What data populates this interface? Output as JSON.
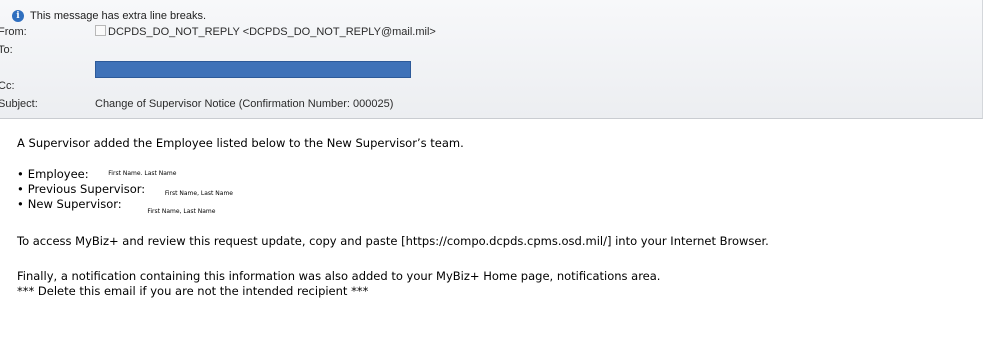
{
  "header": {
    "info_text": "This message has extra line breaks.",
    "info_icon": "info-icon",
    "from_label": "From:",
    "from_value": "DCPDS_DO_NOT_REPLY <DCPDS_DO_NOT_REPLY@mail.mil>",
    "to_label": "To:",
    "cc_label": "Cc:",
    "subject_label": "Subject:",
    "subject_value": "Change of Supervisor Notice (Confirmation Number: 000025)",
    "redaction_color": "#3f72b8"
  },
  "body": {
    "intro": "A Supervisor added the Employee listed below to the New Supervisor’s team.",
    "bullets": [
      {
        "label": "Employee:",
        "value": "First Name. Last Name"
      },
      {
        "label": "Previous Supervisor:",
        "value": "First Name, Last Name"
      },
      {
        "label": "New Supervisor:",
        "value": "First Name, Last Name"
      }
    ],
    "access_text": "To access MyBiz+ and review this request update, copy and paste [https://compo.dcpds.cpms.osd.mil/] into your Internet Browser.",
    "finally_text": "Finally, a notification containing this information was also added to your MyBiz+  Home page, notifications area.",
    "delete_text": "*** Delete this email if you are not the intended recipient ***"
  }
}
